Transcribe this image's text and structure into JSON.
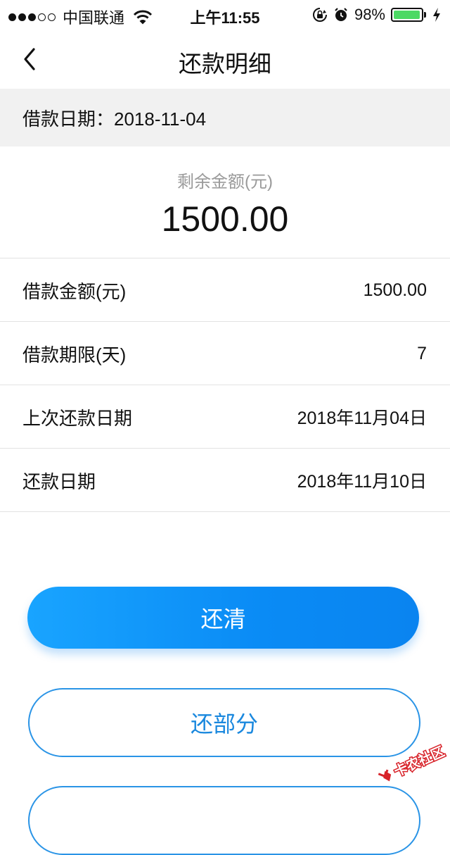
{
  "status_bar": {
    "carrier": "中国联通",
    "time": "上午11:55",
    "battery_percent": "98%",
    "battery_level": 0.98,
    "icons": [
      "signal-dots",
      "wifi-icon",
      "rotation-lock-icon",
      "alarm-icon",
      "battery-icon",
      "charging-bolt-icon"
    ]
  },
  "nav": {
    "title": "还款明细",
    "back_icon": "chevron-left-icon"
  },
  "loan_date": {
    "text": "借款日期：2018-11-04"
  },
  "remaining": {
    "label": "剩余金额(元)",
    "value": "1500.00"
  },
  "details": [
    {
      "label": "借款金额(元)",
      "value": "1500.00"
    },
    {
      "label": "借款期限(天)",
      "value": "7"
    },
    {
      "label": "上次还款日期",
      "value": "2018年11月04日"
    },
    {
      "label": "还款日期",
      "value": "2018年11月10日"
    }
  ],
  "buttons": {
    "repay_all": "还清",
    "repay_partial": "还部分"
  },
  "watermark": {
    "text": "卡农社区"
  },
  "colors": {
    "primary": "#0a8bf5",
    "outline": "#2a94e6",
    "band": "#f1f1f1",
    "muted_text": "#9a9a9a",
    "watermark_red": "#d8232a"
  }
}
